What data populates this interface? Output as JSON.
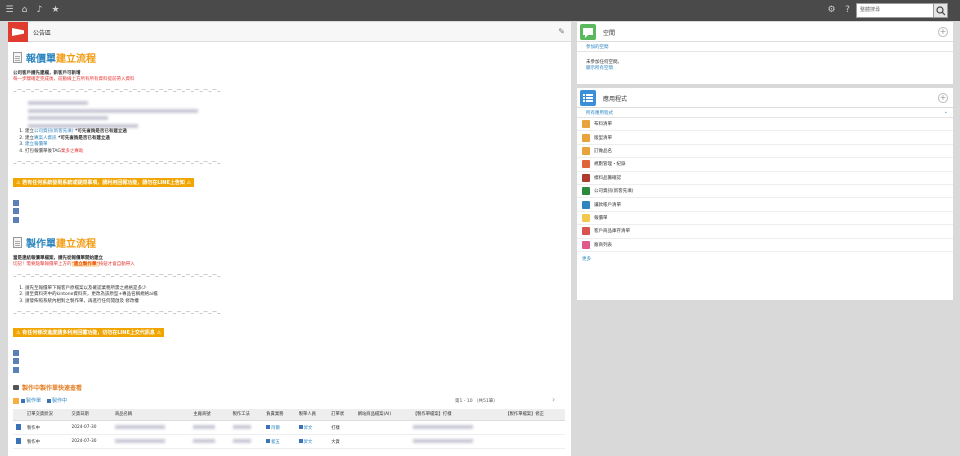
{
  "topbar": {
    "search_placeholder": "整體搜尋"
  },
  "bulletin": {
    "title": "公告區",
    "section1": {
      "title_blue": "報價單",
      "title_orange": "建立流程",
      "line1": "公司客戶請先建檔，新客戶可新增",
      "line2": "每一步驟確定完成後，前動線上方所有所有資料提前帶入資料",
      "steps": [
        {
          "prefix": "建立",
          "link": "公司資訊(新客先填)",
          "suffix": " *可先查詢是否已有建立過"
        },
        {
          "prefix": "建立",
          "link": "專案人資訊",
          "suffix": " *可先查詢是否已有建立過"
        },
        {
          "prefix": "",
          "link": "建立報價單",
          "suffix": ""
        },
        {
          "prefix": "打包報價單後TAG",
          "link": "",
          "suffix": "業多之專助"
        }
      ],
      "banner": "⚠ 若有任何系統發現系統或疑問事項，請利用回報功能，請勿在LINE上告知 ⚠"
    },
    "section2": {
      "title_blue": "製作單",
      "title_orange": "建立流程",
      "line1": "當是連結報價單檔案，請先從報價單開始建立",
      "line2_prefix": "切記！需要點擊報價單上方的",
      "line2_hl": "\"建立製作單\"",
      "line2_suffix": "按鈕才會自動帶入",
      "steps": [
        "請先至報價單下報客戶原檔案以及確認業務所需之規格是多少",
        "請至資料夾中的kintone資料夾，更改為該原型+專品名稱規格ai檔",
        "請發佈照系統內相對之製作單，再進行任何開啟及 修改權"
      ],
      "banner": "⚠ 有任何修改進度請多利用回覆功能，切勿在LINE上交代訊息 ⚠"
    },
    "quicklist": {
      "title": "製作中製作單快速查看",
      "link1": "製作單",
      "link2": "製作中",
      "pager": "第1 - 10 （共51筆）",
      "columns": [
        "訂單交貨狀況",
        "交貨日期",
        "商品名稱",
        "主廠商號",
        "製作工法",
        "負責業務",
        "製單人員",
        "訂單狀",
        "網站商品檔案(AI)",
        "【製作單檔案】打樣",
        "【製作單檔案】修正"
      ],
      "rows": [
        {
          "status": "製作中",
          "date": "2024-07-30",
          "rep": "阿爾",
          "maker": "昇文",
          "state": "打樣"
        },
        {
          "status": "製作中",
          "date": "2024-07-30",
          "rep": "藍五",
          "maker": "昇文",
          "state": "大貨"
        }
      ]
    }
  },
  "space_panel": {
    "title": "空間",
    "sub": "參加的空間",
    "empty_text": "未參加任何空間。",
    "show_all": "顯示所有空間"
  },
  "apps_panel": {
    "title": "應用程式",
    "sub": "所有應用程式",
    "items": [
      {
        "label": "布料清單",
        "icon": "fabric-icon",
        "color": "#e8a33c"
      },
      {
        "label": "版型清單",
        "icon": "pattern-icon",
        "color": "#e8a33c"
      },
      {
        "label": "訂做品名",
        "icon": "product-icon",
        "color": "#e8a33c"
      },
      {
        "label": "規劃管理・紀錄",
        "icon": "plan-icon",
        "color": "#e0643a"
      },
      {
        "label": "樣料品籌確認",
        "icon": "sample-icon",
        "color": "#b03a2e"
      },
      {
        "label": "公司資訊(新客先填)",
        "icon": "company-icon",
        "color": "#2b8a3e"
      },
      {
        "label": "讓款帳戶清單",
        "icon": "account-icon",
        "color": "#2e86c1"
      },
      {
        "label": "報價單",
        "icon": "quote-icon",
        "color": "#f2c94c"
      },
      {
        "label": "客戶商品庫存清單",
        "icon": "inventory-icon",
        "color": "#d9534f"
      },
      {
        "label": "廠商列表",
        "icon": "vendor-icon",
        "color": "#e05a8a"
      }
    ],
    "more": "更多"
  }
}
